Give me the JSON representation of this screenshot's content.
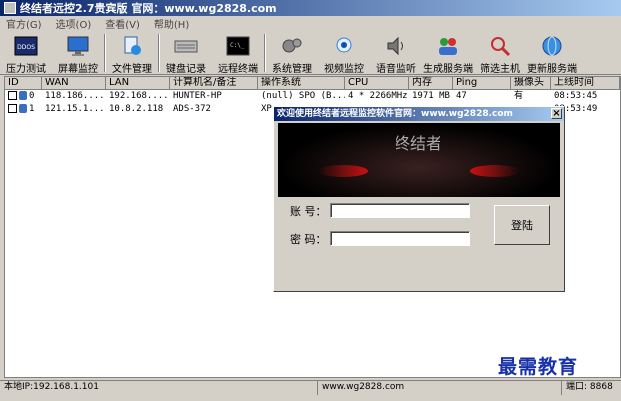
{
  "window": {
    "title": "终结者远控2.7贵宾版 官网：www.wg2828.com"
  },
  "menu": [
    "官方(G)",
    "选项(O)",
    "查看(V)",
    "帮助(H)"
  ],
  "toolbar": [
    {
      "label": "压力测试",
      "icon": "ddos-icon"
    },
    {
      "label": "屏幕监控",
      "icon": "monitor-icon"
    },
    {
      "label": "文件管理",
      "icon": "file-icon"
    },
    {
      "label": "键盘记录",
      "icon": "keyboard-icon"
    },
    {
      "label": "远程终端",
      "icon": "terminal-icon"
    },
    {
      "label": "系统管理",
      "icon": "gears-icon"
    },
    {
      "label": "视频监控",
      "icon": "camera-icon"
    },
    {
      "label": "语音监听",
      "icon": "speaker-icon"
    },
    {
      "label": "生成服务端",
      "icon": "people-icon"
    },
    {
      "label": "筛选主机",
      "icon": "filter-icon"
    },
    {
      "label": "更新服务端",
      "icon": "globe-icon"
    }
  ],
  "table": {
    "headers": [
      "ID",
      "WAN",
      "LAN",
      "计算机名/备注",
      "操作系统",
      "CPU",
      "内存",
      "Ping",
      "摄像头",
      "上线时间"
    ],
    "rows": [
      [
        "0",
        "118.186....",
        "192.168....",
        "HUNTER-HP",
        "(null) SPO (B...",
        "4 * 2266MHz",
        "1971 MB",
        "47",
        "有",
        "08:53:45"
      ],
      [
        "1",
        "121.15.1...",
        "10.8.2.118",
        "ADS-372",
        "XP",
        "",
        "",
        "",
        "",
        "08:53:49"
      ]
    ]
  },
  "status": {
    "local_ip": "本地IP:192.168.1.101",
    "site": "www.wg2828.com",
    "port": "端口: 8868"
  },
  "dialog": {
    "title": "欢迎使用终结者远程监控软件官网：www.wg2828.com",
    "close": "×",
    "banner_text": "终结者",
    "account_label": "账  号：",
    "password_label": "密  码：",
    "account_value": "",
    "password_value": "",
    "login_label": "登陆"
  },
  "watermark": "最需教育",
  "colors": {
    "title_start": "#0a246a",
    "title_end": "#a6caf0",
    "face": "#d4d0c8",
    "watermark": "#1830a8"
  }
}
